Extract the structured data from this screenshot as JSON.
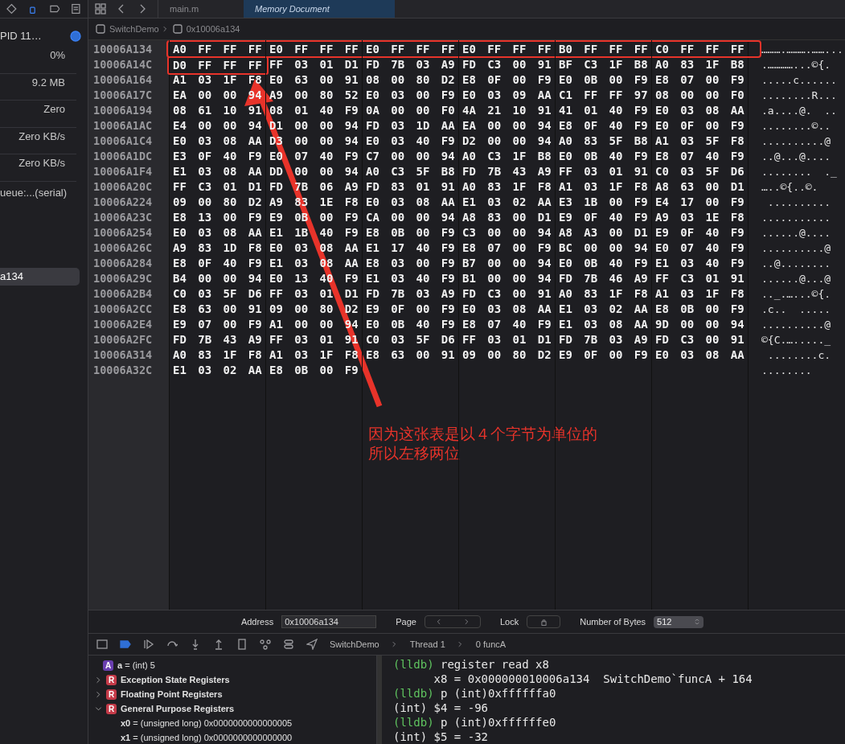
{
  "navigator": {
    "process": "PID 11…",
    "metrics": [
      "0%",
      "9.2 MB",
      "Zero",
      "Zero KB/s",
      "Zero KB/s"
    ],
    "thread": "ueue:...(serial)",
    "frames": [
      {
        "label": "a134",
        "selected": true
      }
    ]
  },
  "tabs": [
    {
      "label": "main.m",
      "selected": false
    },
    {
      "label": "Memory Document",
      "selected": true
    }
  ],
  "breadcrumb": [
    "SwitchDemo",
    "0x10006a134"
  ],
  "hex_rows": [
    {
      "address": "10006A134",
      "groups": [
        "A0 FF FF FF",
        "E0 FF FF FF",
        "E0 FF FF FF",
        "E0 FF FF FF",
        "B0 FF FF FF",
        "C0 FF FF FF"
      ],
      "ascii": "……….……….……...."
    },
    {
      "address": "10006A14C",
      "groups": [
        "D0 FF FF FF",
        "FF 03 01 D1",
        "FD 7B 03 A9",
        "FD C3 00 91",
        "BF C3 1F B8",
        "A0 83 1F B8"
      ],
      "ascii": ".…………...©{."
    },
    {
      "address": "10006A164",
      "groups": [
        "A1 03 1F F8",
        "E0 63 00 91",
        "08 00 80 D2",
        "E8 0F 00 F9",
        "E0 0B 00 F9",
        "E8 07 00 F9"
      ],
      "ascii": ".....c......"
    },
    {
      "address": "10006A17C",
      "groups": [
        "EA 00 00 94",
        "A9 00 80 52",
        "E0 03 00 F9",
        "E0 03 09 AA",
        "C1 FF FF 97",
        "08 00 00 F0"
      ],
      "ascii": "........R..."
    },
    {
      "address": "10006A194",
      "groups": [
        "08 61 10 91",
        "08 01 40 F9",
        "0A 00 00 F0",
        "4A 21 10 91",
        "41 01 40 F9",
        "E0 03 08 AA"
      ],
      "ascii": ".a....@.  .."
    },
    {
      "address": "10006A1AC",
      "groups": [
        "E4 00 00 94",
        "D1 00 00 94",
        "FD 03 1D AA",
        "EA 00 00 94",
        "E8 0F 40 F9",
        "E0 0F 00 F9"
      ],
      "ascii": "........©.."
    },
    {
      "address": "10006A1C4",
      "groups": [
        "E0 03 08 AA",
        "D3 00 00 94",
        "E0 03 40 F9",
        "D2 00 00 94",
        "A0 83 5F B8",
        "A1 03 5F F8"
      ],
      "ascii": "..........@"
    },
    {
      "address": "10006A1DC",
      "groups": [
        "E3 0F 40 F9",
        "E0 07 40 F9",
        "C7 00 00 94",
        "A0 C3 1F B8",
        "E0 0B 40 F9",
        "E8 07 40 F9"
      ],
      "ascii": "..@...@...."
    },
    {
      "address": "10006A1F4",
      "groups": [
        "E1 03 08 AA",
        "DD 00 00 94",
        "A0 C3 5F B8",
        "FD 7B 43 A9",
        "FF 03 01 91",
        "C0 03 5F D6"
      ],
      "ascii": "........  ._"
    },
    {
      "address": "10006A20C",
      "groups": [
        "FF C3 01 D1",
        "FD 7B 06 A9",
        "FD 83 01 91",
        "A0 83 1F F8",
        "A1 03 1F F8",
        "A8 63 00 D1"
      ],
      "ascii": "…..©{..©."
    },
    {
      "address": "10006A224",
      "groups": [
        "09 00 80 D2",
        "A9 83 1E F8",
        "E0 03 08 AA",
        "E1 03 02 AA",
        "E3 1B 00 F9",
        "E4 17 00 F9"
      ],
      "ascii": " .........."
    },
    {
      "address": "10006A23C",
      "groups": [
        "E8 13 00 F9",
        "E9 0B 00 F9",
        "CA 00 00 94",
        "A8 83 00 D1",
        "E9 0F 40 F9",
        "A9 03 1E F8"
      ],
      "ascii": "..........."
    },
    {
      "address": "10006A254",
      "groups": [
        "E0 03 08 AA",
        "E1 1B 40 F9",
        "E8 0B 00 F9",
        "C3 00 00 94",
        "A8 A3 00 D1",
        "E9 0F 40 F9"
      ],
      "ascii": "......@...."
    },
    {
      "address": "10006A26C",
      "groups": [
        "A9 83 1D F8",
        "E0 03 08 AA",
        "E1 17 40 F9",
        "E8 07 00 F9",
        "BC 00 00 94",
        "E0 07 40 F9"
      ],
      "ascii": "..........@"
    },
    {
      "address": "10006A284",
      "groups": [
        "E8 0F 40 F9",
        "E1 03 08 AA",
        "E8 03 00 F9",
        "B7 00 00 94",
        "E0 0B 40 F9",
        "E1 03 40 F9"
      ],
      "ascii": "..@........"
    },
    {
      "address": "10006A29C",
      "groups": [
        "B4 00 00 94",
        "E0 13 40 F9",
        "E1 03 40 F9",
        "B1 00 00 94",
        "FD 7B 46 A9",
        "FF C3 01 91"
      ],
      "ascii": "......@...@"
    },
    {
      "address": "10006A2B4",
      "groups": [
        "C0 03 5F D6",
        "FF 03 01 D1",
        "FD 7B 03 A9",
        "FD C3 00 91",
        "A0 83 1F F8",
        "A1 03 1F F8"
      ],
      "ascii": ".._.…...©{."
    },
    {
      "address": "10006A2CC",
      "groups": [
        "E8 63 00 91",
        "09 00 80 D2",
        "E9 0F 00 F9",
        "E0 03 08 AA",
        "E1 03 02 AA",
        "E8 0B 00 F9"
      ],
      "ascii": ".c..  ....."
    },
    {
      "address": "10006A2E4",
      "groups": [
        "E9 07 00 F9",
        "A1 00 00 94",
        "E0 0B 40 F9",
        "E8 07 40 F9",
        "E1 03 08 AA",
        "9D 00 00 94"
      ],
      "ascii": "..........@"
    },
    {
      "address": "10006A2FC",
      "groups": [
        "FD 7B 43 A9",
        "FF 03 01 91",
        "C0 03 5F D6",
        "FF 03 01 D1",
        "FD 7B 03 A9",
        "FD C3 00 91"
      ],
      "ascii": "©{C.…....._"
    },
    {
      "address": "10006A314",
      "groups": [
        "A0 83 1F F8",
        "A1 03 1F F8",
        "E8 63 00 91",
        "09 00 80 D2",
        "E9 0F 00 F9",
        "E0 03 08 AA"
      ],
      "ascii": " ........c."
    },
    {
      "address": "10006A32C",
      "groups": [
        "E1 03 02 AA",
        "E8 0B 00 F9"
      ],
      "ascii": "........"
    }
  ],
  "annotation": {
    "lines": [
      "因为这张表是以４个字节为单位的",
      "所以左移两位"
    ]
  },
  "memory_bar": {
    "address_label": "Address",
    "address_value": "0x10006a134",
    "page_label": "Page",
    "lock_label": "Lock",
    "bytes_label": "Number of Bytes",
    "bytes_value": "512"
  },
  "debug_breadcrumb": [
    "SwitchDemo",
    "Thread 1",
    "0 funcA"
  ],
  "variables": [
    {
      "kind": "value",
      "badge": "A",
      "text": "**a** = (int) 5"
    },
    {
      "kind": "group",
      "badge": "R",
      "text": "Exception State Registers",
      "expanded": false
    },
    {
      "kind": "group",
      "badge": "R",
      "text": "Floating Point Registers",
      "expanded": false
    },
    {
      "kind": "group",
      "badge": "R",
      "text": "General Purpose Registers",
      "expanded": true,
      "children": [
        {
          "text": "**x0** = (unsigned long) 0x0000000000000005"
        },
        {
          "text": "**x1** = (unsigned long) 0x0000000000000000"
        }
      ]
    }
  ],
  "console": [
    {
      "kind": "command",
      "prompt": "(lldb)",
      "text": "register read x8"
    },
    {
      "kind": "output",
      "text": "      x8 = 0x000000010006a134  SwitchDemo`funcA + 164"
    },
    {
      "kind": "command",
      "prompt": "(lldb)",
      "text": "p (int)0xffffffa0"
    },
    {
      "kind": "output",
      "text": "(int) $4 = -96"
    },
    {
      "kind": "command",
      "prompt": "(lldb)",
      "text": "p (int)0xffffffe0"
    },
    {
      "kind": "output",
      "text": "(int) $5 = -32"
    }
  ]
}
